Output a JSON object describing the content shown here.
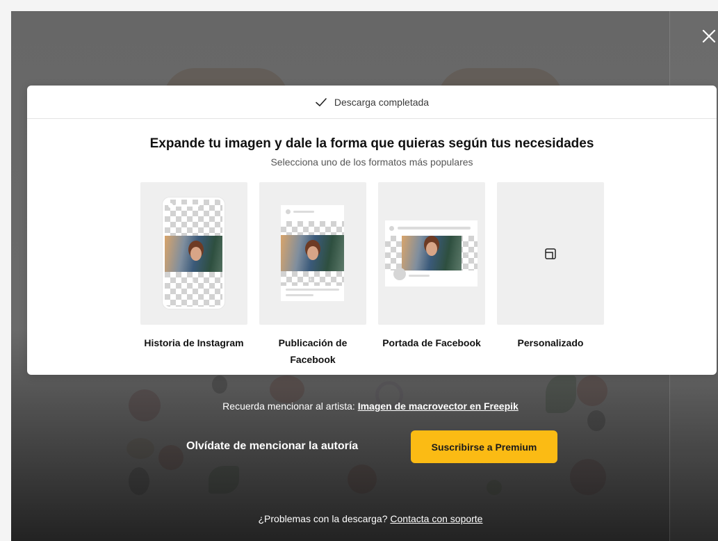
{
  "modal": {
    "status": "Descarga completada",
    "title": "Expande tu imagen y dale la forma que quieras según tus necesidades",
    "subtitle": "Selecciona uno de los formatos más populares",
    "cards": [
      {
        "label": "Historia de Instagram"
      },
      {
        "label": "Publicación de Facebook"
      },
      {
        "label": "Portada de Facebook"
      },
      {
        "label": "Personalizado"
      }
    ]
  },
  "credit": {
    "prefix": "Recuerda mencionar al artista:",
    "link": "Imagen de macrovector en Freepik"
  },
  "promo": {
    "text": "Olvídate de mencionar la autoría",
    "button": "Suscribirse a Premium"
  },
  "support": {
    "prefix": "¿Problemas con la descarga?",
    "link": "Contacta con soporte"
  },
  "icons": {
    "close": "close-icon",
    "check": "check-icon",
    "custom": "expand-frame-icon"
  },
  "colors": {
    "accent": "#fbbb14"
  }
}
